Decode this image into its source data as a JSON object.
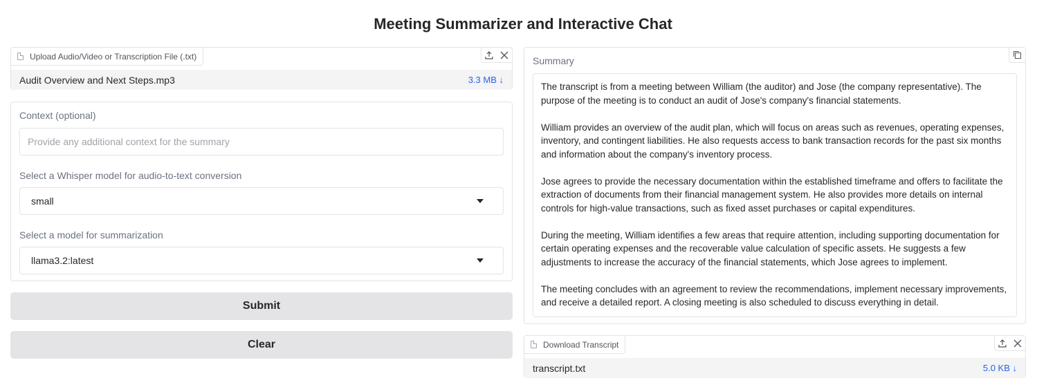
{
  "page": {
    "title": "Meeting Summarizer and Interactive Chat"
  },
  "upload": {
    "tab_label": "Upload Audio/Video or Transcription File (.txt)",
    "file_name": "Audit Overview and Next Steps.mp3",
    "file_size": "3.3 MB ↓",
    "upload_icon": "upload-icon",
    "close_icon": "close-icon"
  },
  "form": {
    "context_label": "Context (optional)",
    "context_placeholder": "Provide any additional context for the summary",
    "context_value": "",
    "whisper_label": "Select a Whisper model for audio-to-text conversion",
    "whisper_value": "small",
    "summ_label": "Select a model for summarization",
    "summ_value": "llama3.2:latest"
  },
  "buttons": {
    "submit": "Submit",
    "clear": "Clear"
  },
  "summary": {
    "label": "Summary",
    "paragraphs": [
      "The transcript is from a meeting between William (the auditor) and Jose (the company representative). The purpose of the meeting is to conduct an audit of Jose's company's financial statements.",
      "William provides an overview of the audit plan, which will focus on areas such as revenues, operating expenses, inventory, and contingent liabilities. He also requests access to bank transaction records for the past six months and information about the company's inventory process.",
      "Jose agrees to provide the necessary documentation within the established timeframe and offers to facilitate the extraction of documents from their financial management system. He also provides more details on internal controls for high-value transactions, such as fixed asset purchases or capital expenditures.",
      "During the meeting, William identifies a few areas that require attention, including supporting documentation for certain operating expenses and the recoverable value calculation of specific assets. He suggests a few adjustments to increase the accuracy of the financial statements, which Jose agrees to implement.",
      "The meeting concludes with an agreement to review the recommendations, implement necessary improvements, and receive a detailed report. A closing meeting is also scheduled to discuss everything in detail."
    ]
  },
  "download": {
    "tab_label": "Download Transcript",
    "file_name": "transcript.txt",
    "file_size": "5.0 KB ↓"
  },
  "colors": {
    "accent_link": "#2563eb",
    "button_bg": "#e4e4e7",
    "border": "#e4e4e7"
  }
}
